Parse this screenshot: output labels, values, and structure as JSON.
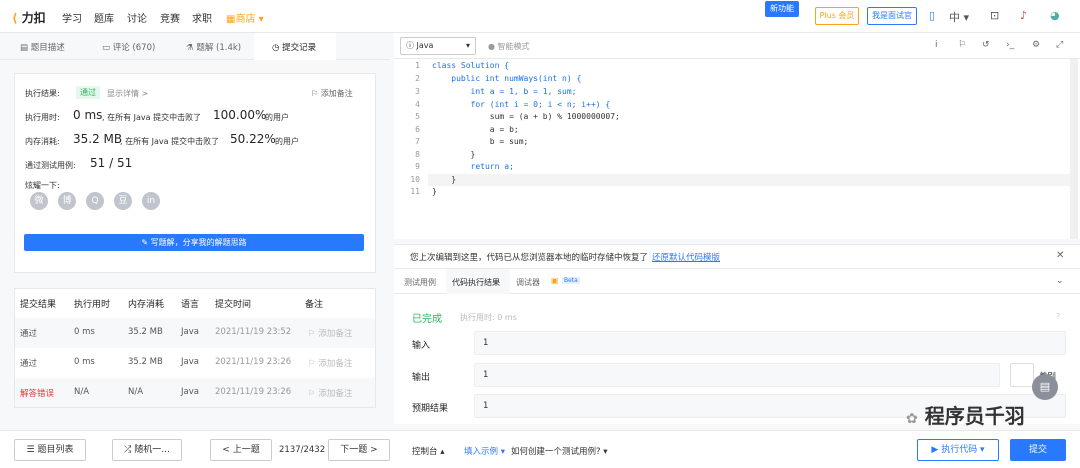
{
  "nav": {
    "logo_text": "力扣",
    "items": [
      "学习",
      "题库",
      "讨论",
      "竞赛",
      "求职",
      "商店"
    ],
    "new_feature": "新功能",
    "plus": "Plus 会员",
    "interviewer": "我是面试官",
    "lang": "中"
  },
  "left_tabs": [
    "题目描述",
    "评论 (670)",
    "题解 (1.4k)",
    "提交记录"
  ],
  "result": {
    "label": "执行结果:",
    "status": "通过",
    "detail": "显示详情 >",
    "add_note": "添加备注",
    "time_label": "执行用时:",
    "time_value": "0 ms",
    "time_beat_prefix": ", 在所有 Java 提交中击败了",
    "time_pct": "100.00%",
    "time_suffix": "的用户",
    "mem_label": "内存消耗:",
    "mem_value": "35.2 MB",
    "mem_beat_prefix": ", 在所有 Java 提交中击败了",
    "mem_pct": "50.22%",
    "mem_suffix": "的用户",
    "cases_label": "通过测试用例:",
    "cases_value": "51 / 51",
    "share_label": "炫耀一下:",
    "share_icons": [
      "微",
      "博",
      "Q",
      "豆",
      "in"
    ],
    "write_btn": "✎ 写题解，分享我的解题思路"
  },
  "table": {
    "headers": [
      "提交结果",
      "执行用时",
      "内存消耗",
      "语言",
      "提交时间",
      "备注"
    ],
    "rows": [
      {
        "result": "通过",
        "time": "0 ms",
        "mem": "35.2 MB",
        "lang": "Java",
        "date": "2021/11/19 23:52",
        "note": "添加备注"
      },
      {
        "result": "通过",
        "time": "0 ms",
        "mem": "35.2 MB",
        "lang": "Java",
        "date": "2021/11/19 23:26",
        "note": "添加备注"
      },
      {
        "result": "解答错误",
        "time": "N/A",
        "mem": "N/A",
        "lang": "Java",
        "date": "2021/11/19 23:26",
        "note": "添加备注"
      }
    ]
  },
  "bottom_left": {
    "list": "☰ 题目列表",
    "random": "⤮ 随机一...",
    "prev": "< 上一题",
    "counter": "2137/2432",
    "next": "下一题 >"
  },
  "editor": {
    "language": "Java",
    "smart_mode": "智能模式",
    "lines": [
      "class Solution {",
      "    public int numWays(int n) {",
      "        int a = 1, b = 1, sum;",
      "        for (int i = 0; i < n; i++) {",
      "            sum = (a + b) % 1000000007;",
      "            a = b;",
      "            b = sum;",
      "        }",
      "        return a;",
      "    }",
      "}"
    ]
  },
  "console": {
    "notice": "您上次编辑到这里，代码已从您浏览器本地的临时存储中恢复了",
    "restore": "还原默认代码模版",
    "tabs": [
      "测试用例",
      "代码执行结果",
      "调试器"
    ],
    "beta": "Beta",
    "done": "已完成",
    "exec_time": "执行用时: 0 ms",
    "input_label": "输入",
    "input_value": "1",
    "output_label": "输出",
    "output_value": "1",
    "diff": "差别",
    "expected_label": "预期结果",
    "expected_value": "1"
  },
  "bottom_right": {
    "console": "控制台 ▴",
    "fill_example": "填入示例 ▾",
    "how_create": "如何创建一个测试用例? ▾",
    "run": "▶ 执行代码 ▾",
    "submit": "提交"
  },
  "watermark": "程序员千羽"
}
